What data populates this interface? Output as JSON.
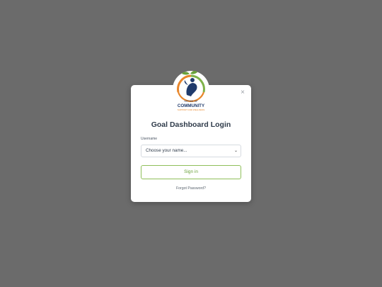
{
  "modal": {
    "title": "Goal Dashboard Login",
    "close_label": "×",
    "username_label": "Username",
    "username_select_value": "Choose your name...",
    "signin_label": "Sign in",
    "forgot_label": "Forgot Password?"
  },
  "logo": {
    "line1": "OFFICE OF",
    "line2": "COMMUNITY",
    "line3": "SUPPORT AND WELLNESS"
  },
  "colors": {
    "backdrop": "#6b6b6b",
    "accent_green": "#6aa13a",
    "logo_orange": "#e8862a",
    "logo_navy": "#1f3a6b"
  },
  "icons": {
    "close": "close-icon",
    "select_arrow": "chevron-down-icon",
    "logo": "community-logo-icon"
  }
}
